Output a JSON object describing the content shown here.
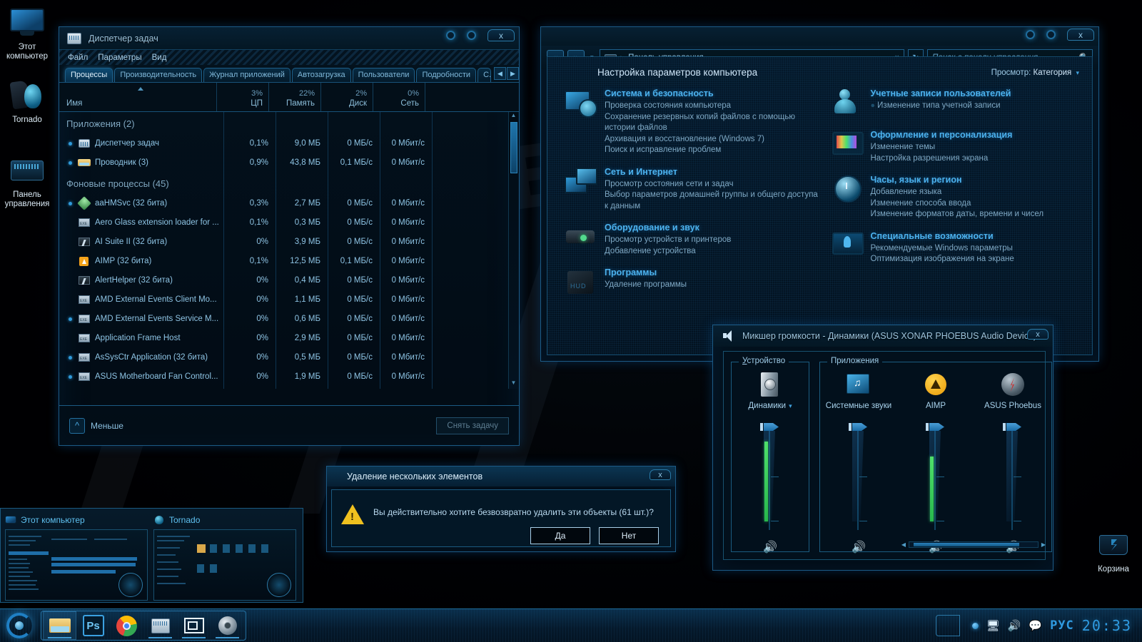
{
  "desktop": {
    "icons": [
      {
        "label": "Этот компьютер",
        "icon": "computer-monitor-icon"
      },
      {
        "label": "Tornado",
        "icon": "tornado-app-icon"
      },
      {
        "label": "Панель управления",
        "icon": "control-panel-icon"
      }
    ],
    "recycle_bin": {
      "label": "Корзина",
      "icon": "recycle-bin-icon"
    }
  },
  "task_manager": {
    "title": "Диспетчер задач",
    "menu": [
      "Файл",
      "Параметры",
      "Вид"
    ],
    "tabs": [
      {
        "label": "Процессы",
        "active": true
      },
      {
        "label": "Производительность",
        "active": false
      },
      {
        "label": "Журнал приложений",
        "active": false
      },
      {
        "label": "Автозагрузка",
        "active": false
      },
      {
        "label": "Пользователи",
        "active": false
      },
      {
        "label": "Подробности",
        "active": false
      },
      {
        "label": "С.",
        "active": false
      }
    ],
    "tab_nav": {
      "prev": "◀",
      "next": "▶"
    },
    "columns": [
      {
        "name": "Имя",
        "pct": ""
      },
      {
        "name": "ЦП",
        "pct": "3%"
      },
      {
        "name": "Память",
        "pct": "22%"
      },
      {
        "name": "Диск",
        "pct": "2%"
      },
      {
        "name": "Сеть",
        "pct": "0%"
      }
    ],
    "groups": [
      {
        "title": "Приложения (2)",
        "rows": [
          {
            "expand": true,
            "icon": "task-manager-icon",
            "name": "Диспетчер задач",
            "cpu": "0,1%",
            "mem": "9,0 МБ",
            "disk": "0 МБ/с",
            "net": "0 Мбит/с"
          },
          {
            "expand": true,
            "icon": "folder-icon",
            "name": "Проводник (3)",
            "cpu": "0,9%",
            "mem": "43,8 МБ",
            "disk": "0,1 МБ/с",
            "net": "0 Мбит/с"
          }
        ]
      },
      {
        "title": "Фоновые процессы (45)",
        "rows": [
          {
            "expand": true,
            "icon": "aahmsvc-icon",
            "name": "aaHMSvc (32 бита)",
            "cpu": "0,3%",
            "mem": "2,7 МБ",
            "disk": "0 МБ/с",
            "net": "0 Мбит/с"
          },
          {
            "expand": false,
            "icon": "exe-icon",
            "name": "Aero Glass extension loader for ...",
            "cpu": "0,1%",
            "mem": "0,3 МБ",
            "disk": "0 МБ/с",
            "net": "0 Мбит/с"
          },
          {
            "expand": false,
            "icon": "ai-suite-icon",
            "name": "AI Suite II (32 бита)",
            "cpu": "0%",
            "mem": "3,9 МБ",
            "disk": "0 МБ/с",
            "net": "0 Мбит/с"
          },
          {
            "expand": false,
            "icon": "aimp-icon",
            "name": "AIMP (32 бита)",
            "cpu": "0,1%",
            "mem": "12,5 МБ",
            "disk": "0,1 МБ/с",
            "net": "0 Мбит/с"
          },
          {
            "expand": false,
            "icon": "ai-suite-icon",
            "name": "AlertHelper (32 бита)",
            "cpu": "0%",
            "mem": "0,4 МБ",
            "disk": "0 МБ/с",
            "net": "0 Мбит/с"
          },
          {
            "expand": false,
            "icon": "exe-icon",
            "name": "AMD External Events Client Mo...",
            "cpu": "0%",
            "mem": "1,1 МБ",
            "disk": "0 МБ/с",
            "net": "0 Мбит/с"
          },
          {
            "expand": true,
            "icon": "exe-icon",
            "name": "AMD External Events Service M...",
            "cpu": "0%",
            "mem": "0,6 МБ",
            "disk": "0 МБ/с",
            "net": "0 Мбит/с"
          },
          {
            "expand": false,
            "icon": "exe-icon",
            "name": "Application Frame Host",
            "cpu": "0%",
            "mem": "2,9 МБ",
            "disk": "0 МБ/с",
            "net": "0 Мбит/с"
          },
          {
            "expand": true,
            "icon": "exe-icon",
            "name": "AsSysCtr Application (32 бита)",
            "cpu": "0%",
            "mem": "0,5 МБ",
            "disk": "0 МБ/с",
            "net": "0 Мбит/с"
          },
          {
            "expand": true,
            "icon": "exe-icon",
            "name": "ASUS Motherboard Fan Control...",
            "cpu": "0%",
            "mem": "1,9 МБ",
            "disk": "0 МБ/с",
            "net": "0 Мбит/с"
          }
        ]
      }
    ],
    "footer": {
      "less_label": "Меньше",
      "end_task_label": "Снять задачу"
    }
  },
  "control_panel": {
    "address": {
      "path": "Панель управления",
      "separator": "▸",
      "caret": "∨"
    },
    "nav": {
      "back": "«",
      "forward": "»",
      "history_caret": "▾",
      "refresh": "↻"
    },
    "search": {
      "placeholder": "Поиск в панели управления",
      "icon": "search-icon"
    },
    "heading": "Настройка параметров компьютера",
    "view_by": {
      "label": "Просмотр:",
      "value": "Категория",
      "caret": "▾"
    },
    "categories_left": [
      {
        "icon": "system-security-icon",
        "title": "Система и безопасность",
        "links": [
          "Проверка состояния компьютера",
          "Сохранение резервных копий файлов с помощью истории файлов",
          "Архивация и восстановление (Windows 7)",
          "Поиск и исправление проблем"
        ]
      },
      {
        "icon": "network-internet-icon",
        "title": "Сеть и Интернет",
        "links": [
          "Просмотр состояния сети и задач",
          "Выбор параметров домашней группы и общего доступа к данным"
        ]
      },
      {
        "icon": "hardware-sound-icon",
        "title": "Оборудование и звук",
        "links": [
          "Просмотр устройств и принтеров",
          "Добавление устройства"
        ]
      },
      {
        "icon": "programs-icon",
        "title": "Программы",
        "links": [
          "Удаление программы"
        ]
      }
    ],
    "categories_right": [
      {
        "icon": "user-accounts-icon",
        "title": "Учетные записи пользователей",
        "links": [
          "Изменение типа учетной записи"
        ],
        "shield_first_link": true
      },
      {
        "icon": "appearance-icon",
        "title": "Оформление и персонализация",
        "links": [
          "Изменение темы",
          "Настройка разрешения экрана"
        ]
      },
      {
        "icon": "clock-language-icon",
        "title": "Часы, язык и регион",
        "links": [
          "Добавление языка",
          "Изменение способа ввода",
          "Изменение форматов даты, времени и чисел"
        ]
      },
      {
        "icon": "ease-of-access-icon",
        "title": "Специальные возможности",
        "links": [
          "Рекомендуемые Windows параметры",
          "Оптимизация изображения на экране"
        ]
      }
    ]
  },
  "volume_mixer": {
    "title": "Микшер громкости - Динамики (ASUS XONAR PHOEBUS Audio Device)",
    "title_icon": "speaker-icon",
    "device_group_label": "Устройство",
    "apps_group_label": "Приложения",
    "device_channel": {
      "icon": "speaker-device-icon",
      "label": "Динамики",
      "caret": "▾",
      "volume": 100,
      "meter": 88,
      "mute_icon": "speaker-on-icon"
    },
    "app_channels": [
      {
        "icon": "system-sounds-icon",
        "label": "Системные звуки",
        "volume": 100,
        "meter": 0,
        "mute_icon": "speaker-on-icon"
      },
      {
        "icon": "aimp-icon",
        "label": "AIMP",
        "volume": 100,
        "meter": 72,
        "mute_icon": "speaker-on-icon"
      },
      {
        "icon": "asus-phoebus-icon",
        "label": "ASUS Phoebus",
        "volume": 100,
        "meter": 0,
        "mute_icon": "speaker-on-icon"
      }
    ],
    "hscroll": {
      "left": "◀",
      "right": "▶"
    }
  },
  "delete_dialog": {
    "title": "Удаление нескольких элементов",
    "message": "Вы действительно хотите безвозвратно удалить эти объекты (61 шт.)?",
    "warning_icon": "warning-triangle-icon",
    "buttons": {
      "yes": "Да",
      "no": "Нет"
    },
    "close": "x"
  },
  "taskbar_thumbnails": [
    {
      "label": "Этот компьютер",
      "icon": "computer-icon"
    },
    {
      "label": "Tornado",
      "icon": "tornado-icon"
    }
  ],
  "taskbar": {
    "start_icon": "start-orb-icon",
    "buttons": [
      {
        "icon": "folder-explorer-icon",
        "active": true
      },
      {
        "icon": "photoshop-icon",
        "label": "Ps",
        "active": false
      },
      {
        "icon": "chrome-icon",
        "active": false
      },
      {
        "icon": "task-manager-icon",
        "active": false
      },
      {
        "icon": "window-tile-icon",
        "active": false
      },
      {
        "icon": "volume-speaker-icon",
        "active": false
      }
    ],
    "tray": {
      "show_desktop_icon": "show-desktop-icon",
      "blue_dot_icon": "tray-indicator-icon",
      "network_icon": "network-icon",
      "volume_icon": "volume-icon",
      "action_center_icon": "action-center-icon",
      "language": "РУС",
      "clock": "20:33"
    }
  },
  "window_buttons": {
    "minimize": "minimize-icon",
    "maximize": "maximize-icon",
    "close": "x"
  },
  "colors": {
    "accent": "#2f9ae0",
    "frame_border": "#1c5a85",
    "category_title": "#4cb2ee",
    "meter_green": "#4fe06a",
    "warning_yellow": "#f0c11f"
  }
}
